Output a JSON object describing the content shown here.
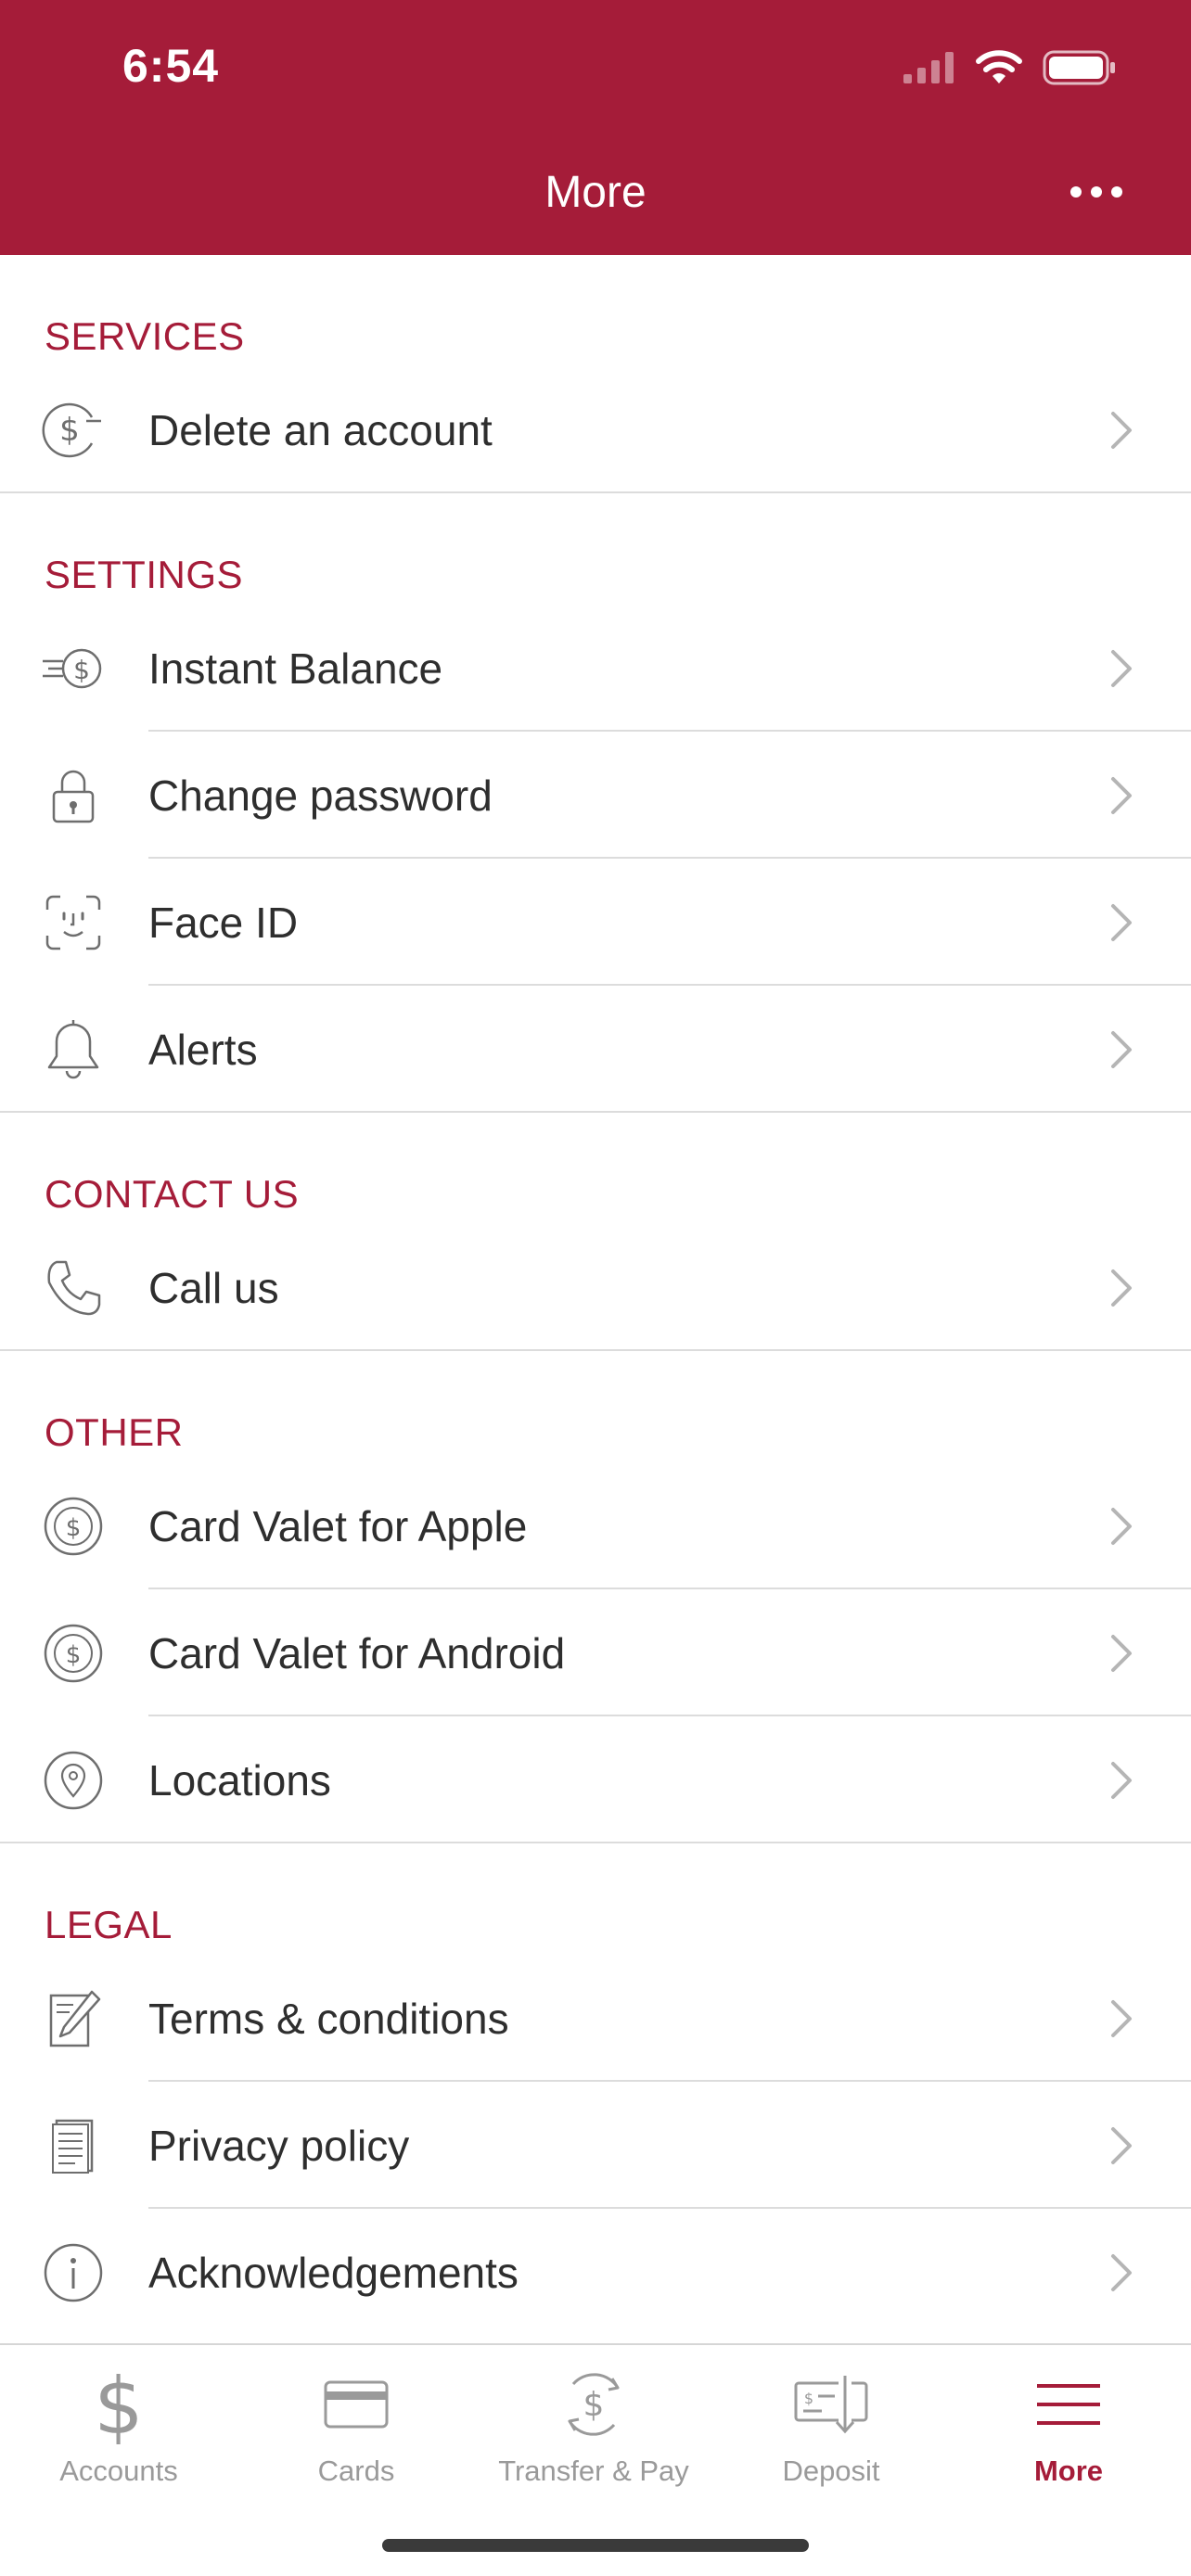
{
  "status_bar": {
    "time": "6:54"
  },
  "header": {
    "title": "More"
  },
  "sections": {
    "services": {
      "title": "SERVICES",
      "items": {
        "delete_account": "Delete an account"
      }
    },
    "settings": {
      "title": "SETTINGS",
      "items": {
        "instant_balance": "Instant Balance",
        "change_password": "Change password",
        "face_id": "Face ID",
        "alerts": "Alerts"
      }
    },
    "contact": {
      "title": "CONTACT US",
      "items": {
        "call_us": "Call us"
      }
    },
    "other": {
      "title": "OTHER",
      "items": {
        "card_valet_apple": "Card Valet for Apple",
        "card_valet_android": "Card Valet for Android",
        "locations": "Locations"
      }
    },
    "legal": {
      "title": "LEGAL",
      "items": {
        "terms": "Terms & conditions",
        "privacy": "Privacy policy",
        "acknowledgements": "Acknowledgements"
      }
    }
  },
  "tabbar": {
    "accounts": "Accounts",
    "cards": "Cards",
    "transfer_pay": "Transfer & Pay",
    "deposit": "Deposit",
    "more": "More"
  },
  "colors": {
    "brand": "#a51c39",
    "icon_gray": "#6e6e6e",
    "chevron": "#b5b5b5"
  }
}
